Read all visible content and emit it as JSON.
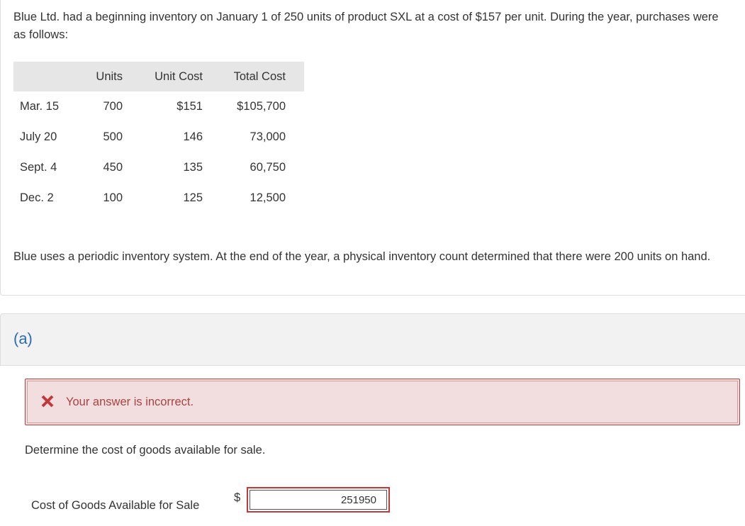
{
  "question": {
    "intro": "Blue Ltd. had a beginning inventory on January 1 of 250 units of product SXL at a cost of $157 per unit. During the year, purchases were as follows:",
    "table": {
      "headers": {
        "date": "",
        "units": "Units",
        "unit_cost": "Unit Cost",
        "total_cost": "Total Cost"
      },
      "rows": [
        {
          "date": "Mar. 15",
          "units": "700",
          "unit_cost": "$151",
          "total_cost": "$105,700"
        },
        {
          "date": "July 20",
          "units": "500",
          "unit_cost": "146",
          "total_cost": "73,000"
        },
        {
          "date": "Sept. 4",
          "units": "450",
          "unit_cost": "135",
          "total_cost": "60,750"
        },
        {
          "date": "Dec. 2",
          "units": "100",
          "unit_cost": "125",
          "total_cost": "12,500"
        }
      ]
    },
    "summary": "Blue uses a periodic inventory system. At the end of the year, a physical inventory count determined that there were 200 units on hand."
  },
  "part": {
    "label": "(a)",
    "feedback": {
      "text": "Your answer is incorrect.",
      "icon": "x-icon",
      "color": "#a94442"
    },
    "prompt": "Determine the cost of goods available for sale.",
    "answer_label": "Cost of Goods Available for Sale",
    "currency_symbol": "$",
    "answer_value": "251950"
  },
  "colors": {
    "accent": "#2c6db3",
    "error": "#c0393b",
    "feedback_bg": "#f2dede"
  }
}
